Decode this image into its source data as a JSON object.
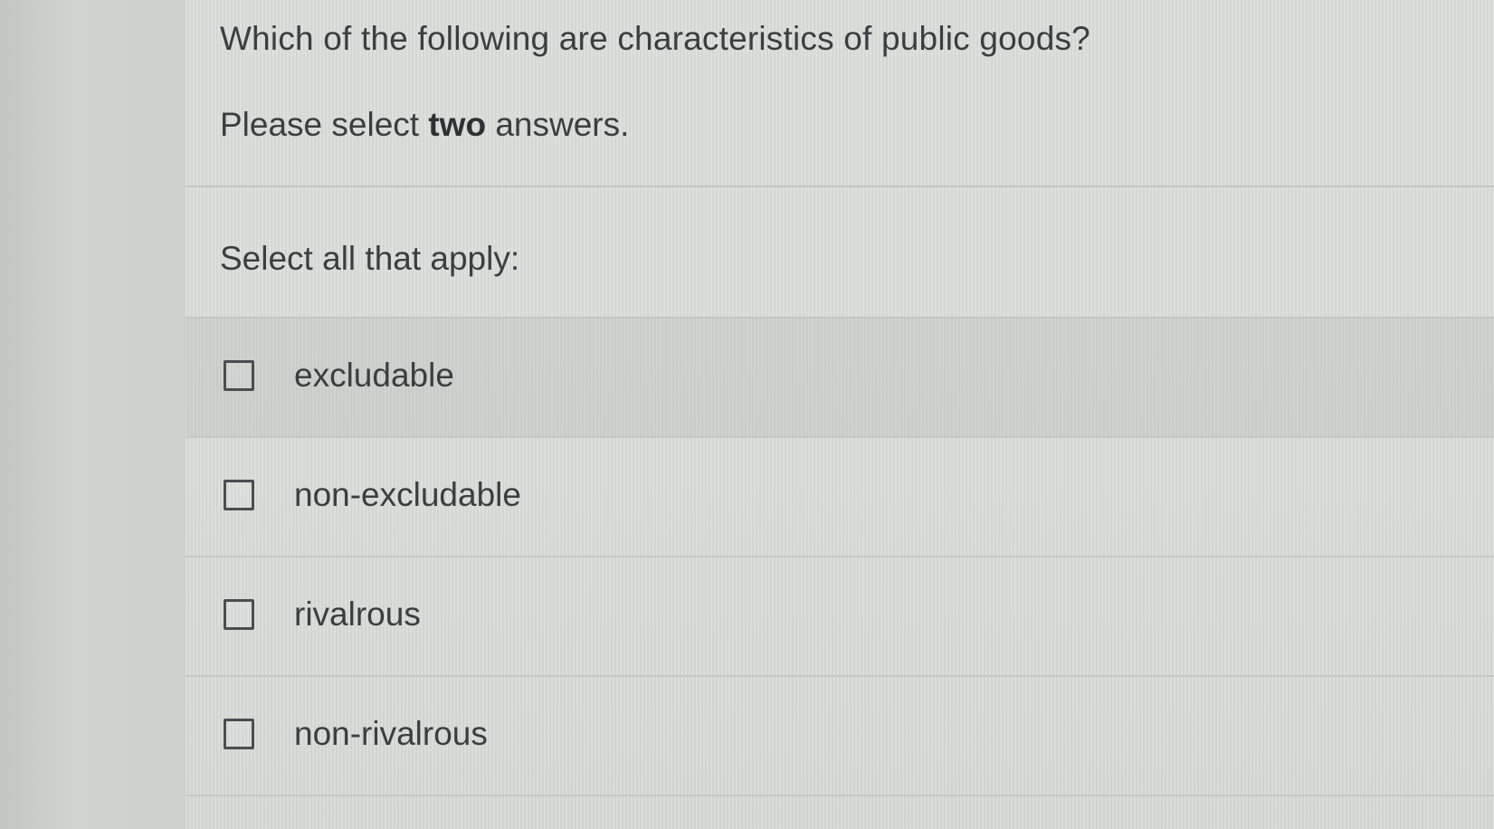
{
  "question": {
    "text": "Which of the following are characteristics of public goods?",
    "instruction_prefix": "Please select ",
    "instruction_bold": "two",
    "instruction_suffix": " answers."
  },
  "select_label": "Select all that apply:",
  "options": [
    {
      "label": "excludable",
      "checked": false
    },
    {
      "label": "non-excludable",
      "checked": false
    },
    {
      "label": "rivalrous",
      "checked": false
    },
    {
      "label": "non-rivalrous",
      "checked": false
    }
  ],
  "colors": {
    "text": "#3b3e40",
    "checkbox_border": "#4a4d50",
    "background": "#d9dcd8"
  }
}
